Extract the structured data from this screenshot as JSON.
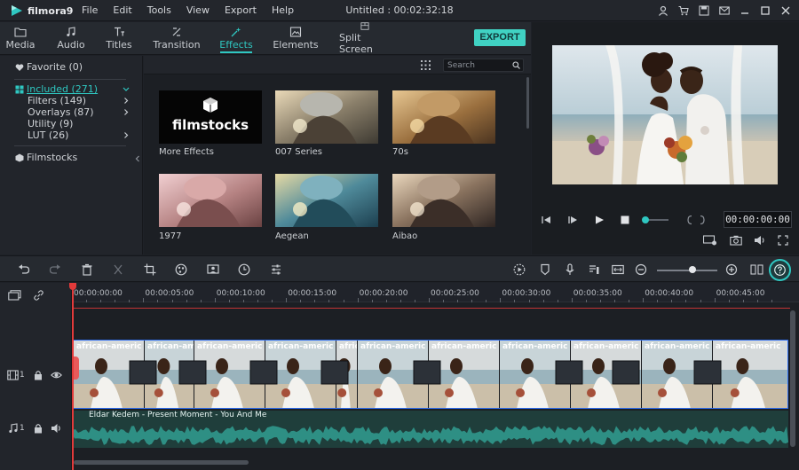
{
  "app": {
    "logo_text": "filmora9",
    "project_title": "Untitled : 00:02:32:18",
    "menu": [
      "File",
      "Edit",
      "Tools",
      "View",
      "Export",
      "Help"
    ],
    "title_icons": [
      "user-icon",
      "cart-icon",
      "save-icon",
      "mail-icon",
      "minimize-icon",
      "maximize-icon",
      "close-icon"
    ]
  },
  "tabs": [
    {
      "label": "Media",
      "icon": "folder-icon",
      "active": false
    },
    {
      "label": "Audio",
      "icon": "music-icon",
      "active": false
    },
    {
      "label": "Titles",
      "icon": "titles-icon",
      "active": false
    },
    {
      "label": "Transition",
      "icon": "transition-icon",
      "active": false
    },
    {
      "label": "Effects",
      "icon": "effects-icon",
      "active": true
    },
    {
      "label": "Elements",
      "icon": "elements-icon",
      "active": false
    },
    {
      "label": "Split Screen",
      "icon": "split-screen-icon",
      "active": false
    }
  ],
  "export_label": "EXPORT",
  "categories": {
    "favorite": "Favorite (0)",
    "included": "Included (271)",
    "filters": "Filters (149)",
    "overlays": "Overlays (87)",
    "utility": "Utility (9)",
    "lut": "LUT (26)",
    "filmstocks": "Filmstocks"
  },
  "search": {
    "placeholder": "Search"
  },
  "effects": [
    {
      "label": "More Effects",
      "brand": "filmstocks"
    },
    {
      "label": "007 Series"
    },
    {
      "label": "70s"
    },
    {
      "label": "1977"
    },
    {
      "label": "Aegean"
    },
    {
      "label": "Aibao"
    }
  ],
  "preview": {
    "timecode": "00:00:00:00",
    "progress": 0
  },
  "timeline": {
    "ruler": [
      "00:00:00:00",
      "00:00:05:00",
      "00:00:10:00",
      "00:00:15:00",
      "00:00:20:00",
      "00:00:25:00",
      "00:00:30:00",
      "00:00:35:00",
      "00:00:40:00",
      "00:00:45:00"
    ],
    "video_track_label": "1",
    "audio_track_label": "1",
    "clip_title": "african-americ",
    "audio_clip_name": "Eldar Kedem - Present Moment - You And Me"
  },
  "colors": {
    "accent": "#2fc7c1",
    "export": "#40d2c3",
    "playhead": "#e23a3a",
    "audio": "#2e8f84"
  }
}
